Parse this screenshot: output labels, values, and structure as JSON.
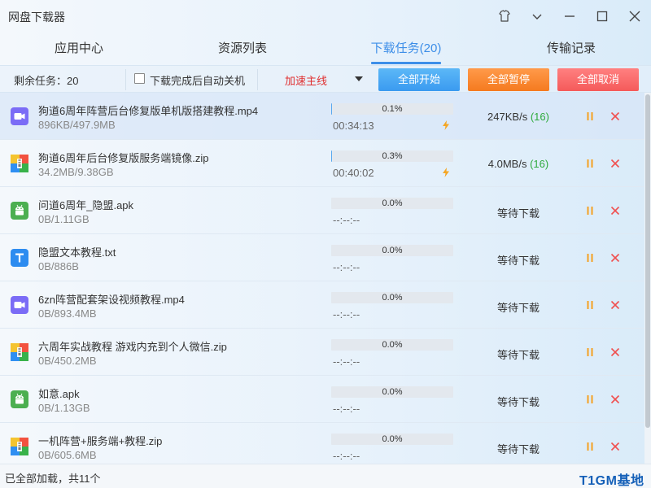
{
  "window": {
    "title": "网盘下载器",
    "controls": [
      "skin-icon",
      "menu-chevron-icon",
      "minimize-icon",
      "maximize-icon",
      "close-icon"
    ]
  },
  "tabs": [
    {
      "label": "应用中心",
      "active": false
    },
    {
      "label": "资源列表",
      "active": false
    },
    {
      "label": "下载任务(20)",
      "active": true
    },
    {
      "label": "传输记录",
      "active": false
    }
  ],
  "toolbar": {
    "remaining": "剩余任务：20",
    "auto_shutdown_label": "下载完成后自动关机",
    "auto_shutdown_checked": false,
    "route_selected": "加速主线",
    "start_all": "全部开始",
    "pause_all": "全部暂停",
    "cancel_all": "全部取消"
  },
  "tasks": [
    {
      "name": "狗道6周年阵营后台修复版单机版搭建教程.mp4",
      "size": "896KB/497.9MB",
      "type": "video",
      "progress": 0.1,
      "progress_text": "0.1%",
      "time_left": "00:34:13",
      "speed": "247KB/s",
      "connections": "(16)",
      "status": ""
    },
    {
      "name": "狗道6周年后台修复版服务端镜像.zip",
      "size": "34.2MB/9.38GB",
      "type": "zip",
      "progress": 0.3,
      "progress_text": "0.3%",
      "time_left": "00:40:02",
      "speed": "4.0MB/s",
      "connections": "(16)",
      "status": ""
    },
    {
      "name": "问道6周年_隐盟.apk",
      "size": "0B/1.11GB",
      "type": "apk",
      "progress": 0.0,
      "progress_text": "0.0%",
      "time_left": "--:--:--",
      "speed": "",
      "connections": "",
      "status": "等待下载"
    },
    {
      "name": "隐盟文本教程.txt",
      "size": "0B/886B",
      "type": "txt",
      "progress": 0.0,
      "progress_text": "0.0%",
      "time_left": "--:--:--",
      "speed": "",
      "connections": "",
      "status": "等待下载"
    },
    {
      "name": "6zn阵营配套架设视频教程.mp4",
      "size": "0B/893.4MB",
      "type": "video",
      "progress": 0.0,
      "progress_text": "0.0%",
      "time_left": "--:--:--",
      "speed": "",
      "connections": "",
      "status": "等待下载"
    },
    {
      "name": "六周年实战教程 游戏内充到个人微信.zip",
      "size": "0B/450.2MB",
      "type": "zip",
      "progress": 0.0,
      "progress_text": "0.0%",
      "time_left": "--:--:--",
      "speed": "",
      "connections": "",
      "status": "等待下载"
    },
    {
      "name": "如意.apk",
      "size": "0B/1.13GB",
      "type": "apk",
      "progress": 0.0,
      "progress_text": "0.0%",
      "time_left": "--:--:--",
      "speed": "",
      "connections": "",
      "status": "等待下载"
    },
    {
      "name": "一机阵营+服务端+教程.zip",
      "size": "0B/605.6MB",
      "type": "zip",
      "progress": 0.0,
      "progress_text": "0.0%",
      "time_left": "--:--:--",
      "speed": "",
      "connections": "",
      "status": "等待下载"
    }
  ],
  "statusbar": {
    "message": "已全部加载，共11个",
    "watermark": "T1GM基地"
  },
  "colors": {
    "accent": "#3d8ee8",
    "start": "#3a9af0",
    "pause": "#f57a1f",
    "cancel": "#f55a5a",
    "route_text": "#e03030",
    "connections": "#2eaa3c"
  }
}
